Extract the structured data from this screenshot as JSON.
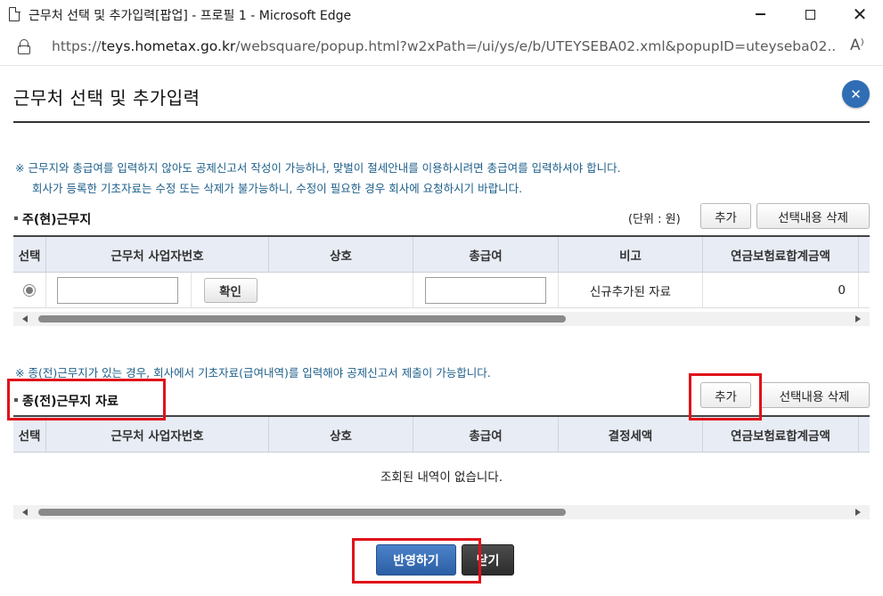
{
  "window": {
    "title": "근무처 선택 및 추가입력[팝업] - 프로필 1 - Microsoft Edge",
    "url_prefix": "https://",
    "url_host": "teys.hometax.go.kr",
    "url_rest": "/websquare/popup.html?w2xPath=/ui/ys/e/b/UTEYSEBA02.xml&popupID=uteyseba02...",
    "read_aloud": "A⁾"
  },
  "popup": {
    "title": "근무처 선택 및 추가입력",
    "notice_1": "※ 근무지와 총급여를 입력하지 않아도 공제신고서 작성이 가능하나, 맞벌이 절세안내를 이용하시려면 총급여를 입력하셔야 합니다.",
    "notice_2": "회사가 등록한 기초자료는 수정 또는 삭제가 불가능하니, 수정이 필요한 경우 회사에 요청하시기 바랍니다.",
    "notice_3": "※ 종(전)근무지가 있는 경우, 회사에서 기초자료(급여내역)를 입력해야 공제신고서 제출이 가능합니다."
  },
  "current_section": {
    "label": "주(현)근무지",
    "unit": "(단위 : 원)",
    "add_label": "추가",
    "delete_label": "선택내용 삭제",
    "columns": [
      "선택",
      "근무처 사업자번호",
      "상호",
      "총급여",
      "비고",
      "연금보험료합계금액"
    ],
    "row": {
      "confirm_label": "확인",
      "note": "신규추가된 자료",
      "pension_total": "0",
      "selected": true
    }
  },
  "previous_section": {
    "label": "종(전)근무지 자료",
    "add_label": "추가",
    "delete_label": "선택내용 삭제",
    "columns": [
      "선택",
      "근무처 사업자번호",
      "상호",
      "총급여",
      "결정세액",
      "연금보험료합계금액"
    ],
    "empty_message": "조회된 내역이 없습니다."
  },
  "footer": {
    "apply_label": "반영하기",
    "close_label": "닫기"
  },
  "colors": {
    "notice_text": "#1e5f8a",
    "header_bg": "#e8ecf5",
    "primary_button": "#2c5fa5",
    "highlight": "#e0121a"
  }
}
